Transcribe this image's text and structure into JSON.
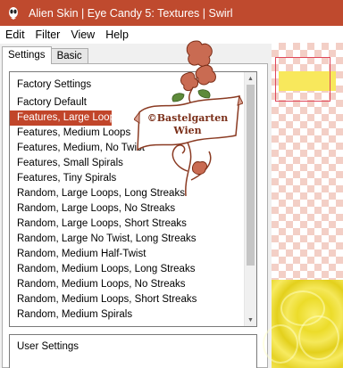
{
  "window": {
    "title": "Alien Skin | Eye Candy 5: Textures | Swirl"
  },
  "menu": {
    "items": [
      "Edit",
      "Filter",
      "View",
      "Help"
    ]
  },
  "tabs": [
    {
      "label": "Settings",
      "active": true
    },
    {
      "label": "Basic",
      "active": false
    }
  ],
  "settings": {
    "factory_header": "Factory Settings",
    "items": [
      "Factory Default",
      "Features, Large Loops",
      "Features, Medium Loops",
      "Features, Medium, No Twist",
      "Features, Small Spirals",
      "Features, Tiny Spirals",
      "Random, Large Loops, Long Streaks",
      "Random, Large Loops, No Streaks",
      "Random, Large Loops, Short Streaks",
      "Random, Large No Twist, Long Streaks",
      "Random, Medium Half-Twist",
      "Random, Medium Loops, Long Streaks",
      "Random, Medium Loops, No Streaks",
      "Random, Medium Loops, Short Streaks",
      "Random, Medium Spirals"
    ],
    "selected_index": 1,
    "user_header": "User Settings"
  },
  "watermark": {
    "line1": "©Bastelgarten",
    "line2": "Wien"
  },
  "colors": {
    "titlebar": "#bf4a2e",
    "selection": "#c1452a",
    "preview_yellow": "#f8e85c",
    "marquee": "#e0475a"
  }
}
